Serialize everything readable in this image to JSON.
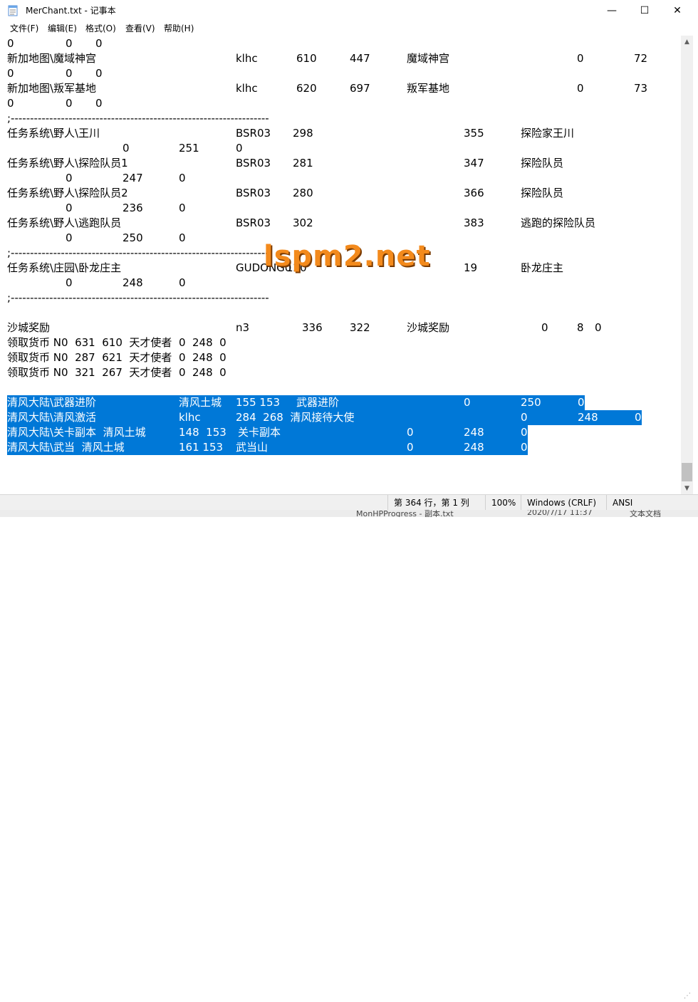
{
  "window": {
    "title": "MerChant.txt - 记事本",
    "minimize": "—",
    "maximize": "☐",
    "close": "✕"
  },
  "menu": [
    "文件(F)",
    "编辑(E)",
    "格式(O)",
    "查看(V)",
    "帮助(H)"
  ],
  "lines": [
    {
      "sel": false,
      "segs": [
        [
          "0",
          ""
        ],
        [
          "0",
          ""
        ],
        [
          "0",
          ""
        ]
      ]
    },
    {
      "sel": false,
      "segs": [
        [
          "新加地图\\魔域神宫",
          ""
        ],
        [
          "klhc",
          ""
        ],
        [
          "610",
          ""
        ],
        [
          "447",
          ""
        ],
        [
          "魔域神宫",
          ""
        ],
        [
          "0",
          ""
        ],
        [
          "72",
          ""
        ]
      ]
    },
    {
      "sel": false,
      "segs": [
        [
          "0",
          ""
        ],
        [
          "0",
          ""
        ],
        [
          "0",
          ""
        ]
      ]
    },
    {
      "sel": false,
      "segs": [
        [
          "新加地图\\叛军基地",
          ""
        ],
        [
          "klhc",
          ""
        ],
        [
          "620",
          ""
        ],
        [
          "697",
          ""
        ],
        [
          "叛军基地",
          ""
        ],
        [
          "0",
          ""
        ],
        [
          "73",
          ""
        ]
      ]
    },
    {
      "sel": false,
      "segs": [
        [
          "0",
          ""
        ],
        [
          "0",
          ""
        ],
        [
          "0",
          ""
        ]
      ]
    },
    {
      "sel": false,
      "segs": [
        [
          ";-------------------------------------------------------------------",
          ""
        ]
      ]
    },
    {
      "sel": false,
      "segs": [
        [
          "任务系统\\野人\\王川",
          ""
        ],
        [
          "BSR03",
          ""
        ],
        [
          "298",
          ""
        ],
        [
          "355",
          ""
        ],
        [
          "探险家王川",
          ""
        ]
      ]
    },
    {
      "sel": false,
      "segs": [
        [
          "0",
          ""
        ],
        [
          "251",
          ""
        ],
        [
          "0",
          ""
        ]
      ]
    },
    {
      "sel": false,
      "segs": [
        [
          "任务系统\\野人\\探险队员1",
          ""
        ],
        [
          "BSR03",
          ""
        ],
        [
          "281",
          ""
        ],
        [
          "347",
          ""
        ],
        [
          "探险队员",
          ""
        ]
      ]
    },
    {
      "sel": false,
      "segs": [
        [
          "0",
          ""
        ],
        [
          "247",
          ""
        ],
        [
          "0",
          ""
        ]
      ]
    },
    {
      "sel": false,
      "segs": [
        [
          "任务系统\\野人\\探险队员2",
          ""
        ],
        [
          "BSR03",
          ""
        ],
        [
          "280",
          ""
        ],
        [
          "366",
          ""
        ],
        [
          "探险队员",
          ""
        ]
      ]
    },
    {
      "sel": false,
      "segs": [
        [
          "0",
          ""
        ],
        [
          "236",
          ""
        ],
        [
          "0",
          ""
        ]
      ]
    },
    {
      "sel": false,
      "segs": [
        [
          "任务系统\\野人\\逃跑队员",
          ""
        ],
        [
          "BSR03",
          ""
        ],
        [
          "302",
          ""
        ],
        [
          "383",
          ""
        ],
        [
          "逃跑的探险队员",
          ""
        ]
      ]
    },
    {
      "sel": false,
      "segs": [
        [
          "0",
          ""
        ],
        [
          "250",
          ""
        ],
        [
          "0",
          ""
        ]
      ]
    },
    {
      "sel": false,
      "segs": [
        [
          ";-------------------------------------------------------------------",
          ""
        ]
      ]
    },
    {
      "sel": false,
      "segs": [
        [
          "任务系统\\庄园\\卧龙庄主",
          ""
        ],
        [
          "GUDONG0",
          ""
        ],
        [
          "120",
          ""
        ],
        [
          "19",
          ""
        ],
        [
          "卧龙庄主",
          ""
        ]
      ]
    },
    {
      "sel": false,
      "segs": [
        [
          "0",
          ""
        ],
        [
          "248",
          ""
        ],
        [
          "0",
          ""
        ]
      ]
    },
    {
      "sel": false,
      "segs": [
        [
          ";-------------------------------------------------------------------",
          ""
        ]
      ]
    },
    {
      "sel": false,
      "segs": []
    },
    {
      "sel": false,
      "segs": [
        [
          "沙城奖励",
          ""
        ],
        [
          "n3",
          ""
        ],
        [
          "336",
          ""
        ],
        [
          "322",
          ""
        ],
        [
          "沙城奖励",
          ""
        ],
        [
          "0",
          ""
        ],
        [
          "8",
          ""
        ],
        [
          "0",
          ""
        ]
      ]
    },
    {
      "sel": false,
      "segs": [
        [
          "领取货币 N0  631  610  天才使者  0  248  0",
          ""
        ]
      ]
    },
    {
      "sel": false,
      "segs": [
        [
          "领取货币 N0  287  621  天才使者  0  248  0",
          ""
        ]
      ]
    },
    {
      "sel": false,
      "segs": [
        [
          "领取货币 N0  321  267  天才使者  0  248  0",
          ""
        ]
      ]
    },
    {
      "sel": false,
      "segs": []
    },
    {
      "sel": true,
      "segs": [
        [
          "清风大陆\\武器进阶",
          ""
        ],
        [
          "清风土城",
          ""
        ],
        [
          "155 153",
          ""
        ],
        [
          "武器进阶",
          ""
        ],
        [
          "0",
          ""
        ],
        [
          "250",
          ""
        ],
        [
          "0",
          ""
        ]
      ]
    },
    {
      "sel": true,
      "segs": [
        [
          "清风大陆\\清风激活",
          ""
        ],
        [
          "klhc",
          ""
        ],
        [
          "284  268  清风接待大使",
          ""
        ],
        [
          "0",
          ""
        ],
        [
          "248",
          ""
        ],
        [
          "0",
          ""
        ]
      ]
    },
    {
      "sel": true,
      "segs": [
        [
          "清风大陆\\关卡副本  清风土城",
          ""
        ],
        [
          "148  153",
          ""
        ],
        [
          "关卡副本",
          ""
        ],
        [
          "0",
          ""
        ],
        [
          "248",
          ""
        ],
        [
          "0",
          ""
        ]
      ]
    },
    {
      "sel": true,
      "segs": [
        [
          "清风大陆\\武当  清风土城",
          ""
        ],
        [
          "161 153",
          ""
        ],
        [
          "武当山",
          ""
        ],
        [
          "0",
          ""
        ],
        [
          "248",
          ""
        ],
        [
          "0",
          ""
        ]
      ]
    }
  ],
  "status": {
    "position": "第 364 行，第 1 列",
    "zoom": "100%",
    "eol": "Windows (CRLF)",
    "encoding": "ANSI"
  },
  "taskbar_peek": {
    "file": "MonHPProgress - 副本.txt",
    "date": "2020/7/17 11:37",
    "type": "文本文档"
  },
  "watermark": "lspm2.net"
}
